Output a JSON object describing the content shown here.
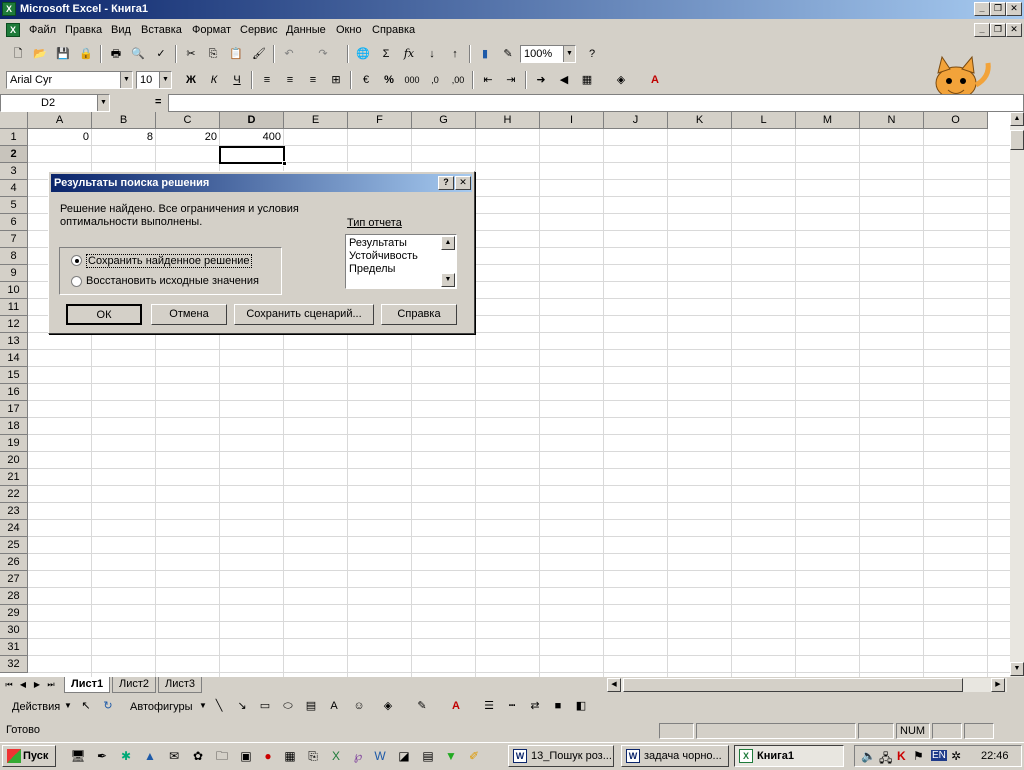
{
  "app": {
    "title": "Microsoft Excel - Книга1",
    "icon": "excel-icon",
    "window_controls": [
      "_",
      "❐",
      "✕"
    ]
  },
  "menu": {
    "items": [
      "Файл",
      "Правка",
      "Вид",
      "Вставка",
      "Формат",
      "Сервис",
      "Данные",
      "Окно",
      "Справка"
    ]
  },
  "toolbar_std": {
    "zoom": "100%"
  },
  "toolbar_fmt": {
    "font": "Arial Cyr",
    "size": "10",
    "bold": "Ж",
    "italic": "К",
    "underline": "Ч",
    "percent": "%",
    "thousands": "000"
  },
  "formula_bar": {
    "name_box": "D2",
    "equals": "=",
    "value": ""
  },
  "grid": {
    "columns": [
      "A",
      "B",
      "C",
      "D",
      "E",
      "F",
      "G",
      "H",
      "I",
      "J",
      "K",
      "L",
      "M",
      "N",
      "O"
    ],
    "rows": [
      "1",
      "2",
      "3",
      "4",
      "5",
      "6",
      "7",
      "8",
      "9",
      "10",
      "11",
      "12",
      "13",
      "14",
      "15",
      "16",
      "17",
      "18",
      "19",
      "20",
      "21",
      "22",
      "23",
      "24",
      "25",
      "26",
      "27",
      "28",
      "29",
      "30",
      "31",
      "32"
    ],
    "cells": {
      "A1": "0",
      "B1": "8",
      "C1": "20",
      "D1": "400"
    },
    "active_cell": "D2"
  },
  "sheets": {
    "tabs": [
      "Лист1",
      "Лист2",
      "Лист3"
    ],
    "active": "Лист1"
  },
  "drawing_toolbar": {
    "actions": "Действия",
    "autoshapes": "Автофигуры"
  },
  "status": {
    "ready": "Готово",
    "num": "NUM"
  },
  "dialog": {
    "title": "Результаты поиска решения",
    "message": "Решение найдено. Все ограничения и условия оптимальности выполнены.",
    "report_label": "Тип отчета",
    "reports": [
      "Результаты",
      "Устойчивость",
      "Пределы"
    ],
    "radio_keep": "Сохранить найденное решение",
    "radio_restore": "Восстановить исходные значения",
    "btn_ok": "ОК",
    "btn_cancel": "Отмена",
    "btn_save_scenario": "Сохранить сценарий...",
    "btn_help": "Справка",
    "help_q": "?",
    "close_x": "✕"
  },
  "taskbar": {
    "start": "Пуск",
    "tasks": [
      "13_Пошук роз...",
      "задача чорно...",
      "Книга1"
    ],
    "lang": "EN",
    "clock": "22:46"
  }
}
